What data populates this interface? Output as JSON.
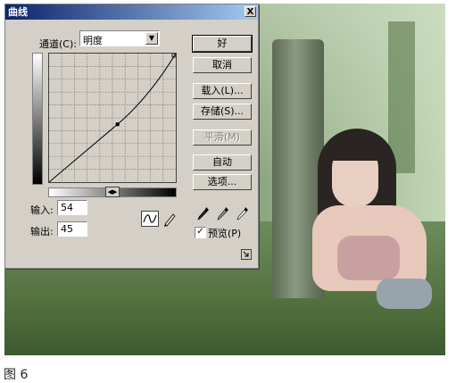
{
  "dialog": {
    "title": "曲线",
    "close_glyph": "X",
    "channel_label": "通道(C):",
    "channel_value": "明度",
    "input_label": "输入:",
    "input_value": "54",
    "output_label": "输出:",
    "output_value": "45",
    "curve_point": {
      "input": 54,
      "output": 45
    },
    "buttons": {
      "ok": "好",
      "cancel": "取消",
      "load": "载入(L)...",
      "save": "存储(S)...",
      "smooth": "平滑(M)",
      "auto": "自动",
      "options": "选项..."
    },
    "preview_label": "预览(P)",
    "preview_checked": true,
    "check_glyph": "✓"
  },
  "caption": "图 6"
}
